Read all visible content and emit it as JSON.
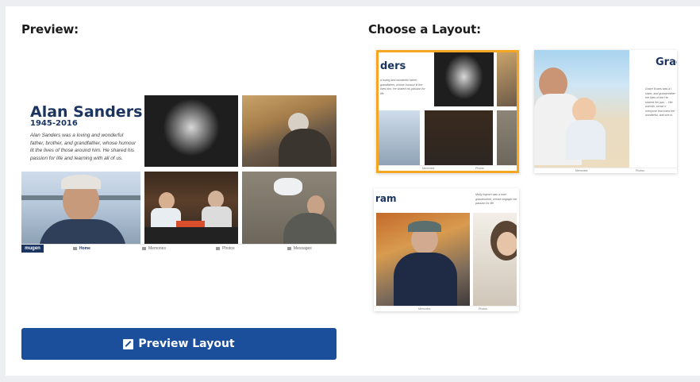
{
  "preview": {
    "heading": "Preview:",
    "name": "Alan Sanders",
    "dates": "1945-2016",
    "bio": "Alan Sanders was a loving and wonderful father, brother, and grandfather, whose humour lit the lives of those around him. He shared his passion for life and learning with all of us.",
    "nav": {
      "logo": "mugen",
      "home": "Home",
      "memories": "Memories",
      "photos": "Photos",
      "messages": "Messages"
    },
    "button_label": "Preview Layout"
  },
  "layouts": {
    "heading": "Choose a Layout:",
    "items": [
      {
        "title": "ders",
        "text": "a loving and wonderful father, grandfather, whose humour lit the lives him. He shared his passion for life",
        "nav1": "Memories",
        "nav2": "Photos",
        "selected": true
      },
      {
        "title": "Grac",
        "text": "Grace Evans was a l sister, and grandmother the lives of the He shared her pas ... Her warmth, sense o everyone that knew her wonderful, and she is",
        "nav1": "Memories",
        "nav2": "Photos",
        "selected": false
      },
      {
        "title": "ram",
        "text": "Molly Ingram was a lovin grandmother, whose engagin her passion for life",
        "nav1": "Memories",
        "nav2": "Photos",
        "selected": false
      }
    ]
  },
  "colors": {
    "accent": "#1b4f9c",
    "navy": "#1b3560",
    "selected": "#f5a623"
  }
}
